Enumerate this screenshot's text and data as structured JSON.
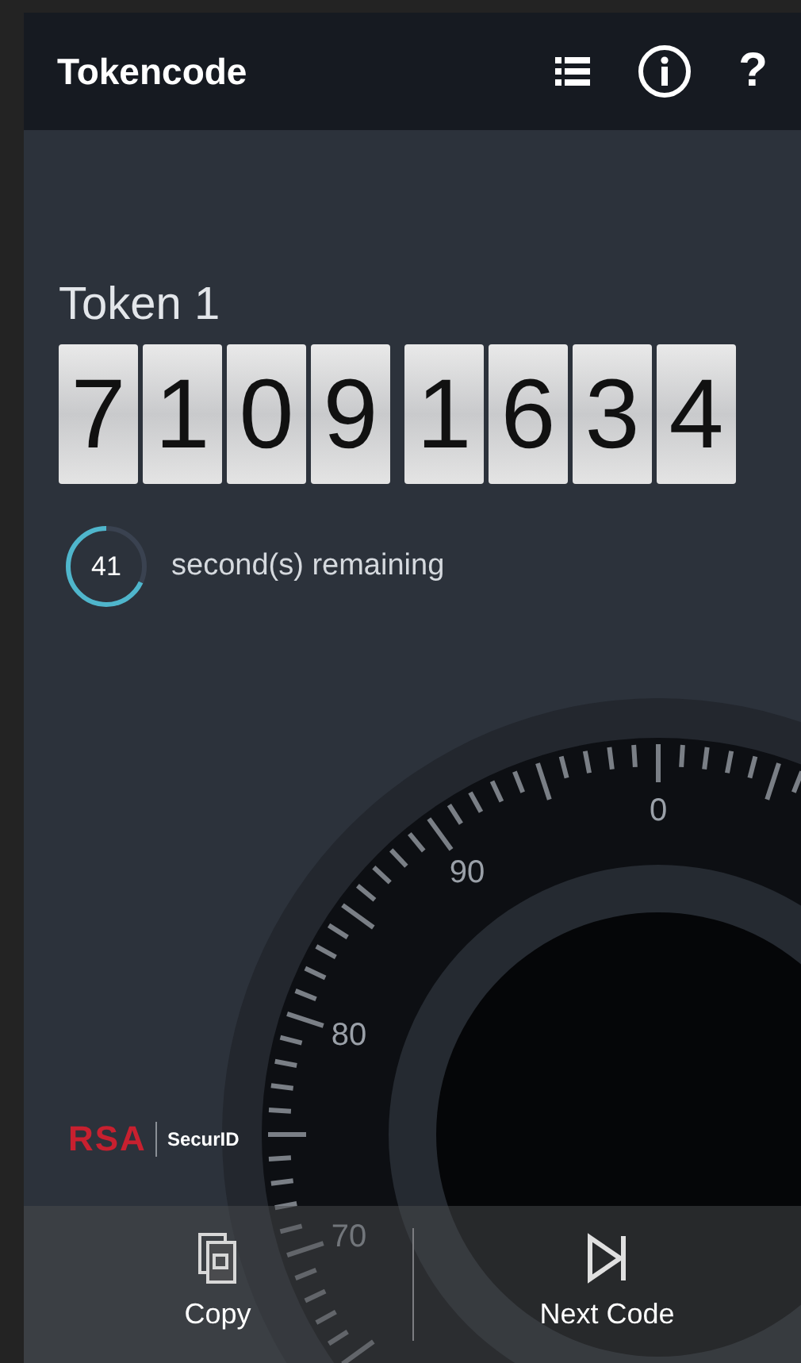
{
  "app_bar": {
    "title": "Tokencode",
    "actions": [
      {
        "kind": "list"
      },
      {
        "kind": "info"
      },
      {
        "kind": "help",
        "label": "?"
      }
    ]
  },
  "token": {
    "name": "Token 1",
    "code_groups": [
      "7109",
      "1634"
    ]
  },
  "countdown": {
    "seconds": "41",
    "level": 0.68,
    "label": "second(s) remaining"
  },
  "dial": {
    "numbers": [
      "0",
      "90",
      "80",
      "70"
    ]
  },
  "brand": {
    "company": "RSA",
    "product": "SecurID"
  },
  "bottom_bar": [
    {
      "kind": "copy",
      "label": "Copy"
    },
    {
      "kind": "next",
      "label": "Next Code"
    }
  ]
}
